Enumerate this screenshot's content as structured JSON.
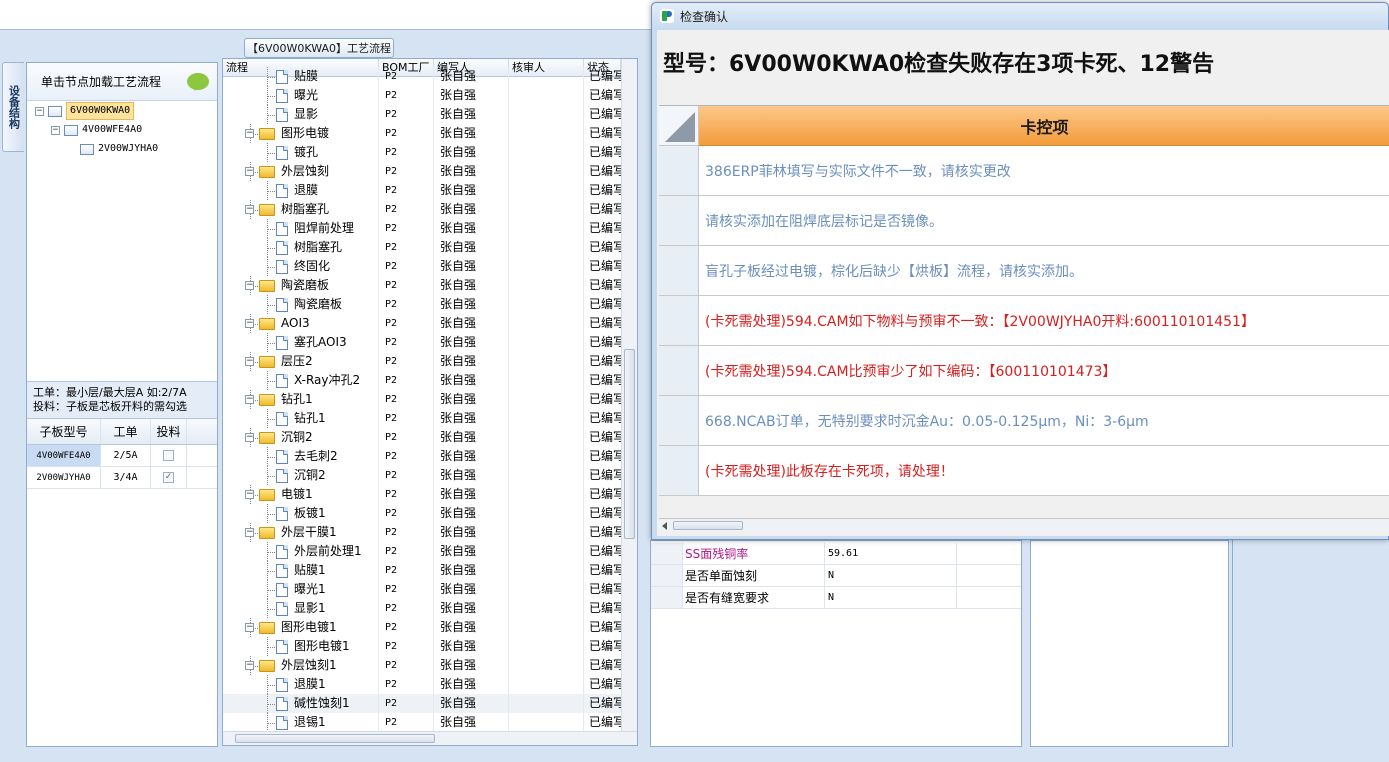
{
  "left": {
    "vtab": "设备结构",
    "header": "单击节点加载工艺流程",
    "tree": [
      {
        "label": "6V00W0KWA0",
        "level": 0,
        "selected": true
      },
      {
        "label": "4V00WFE4A0",
        "level": 1,
        "selected": false
      },
      {
        "label": "2V00WJYHA0",
        "level": 2,
        "selected": false
      }
    ],
    "info_line1": "工单：最小层/最大层A 如:2/7A",
    "info_line2": "投料：子板是芯板开料的需勾选",
    "subtable": {
      "headers": [
        "子板型号",
        "工单",
        "投料"
      ],
      "rows": [
        {
          "model": "4V00WFE4A0",
          "order": "2/5A",
          "feed": "",
          "highlight": true
        },
        {
          "model": "2V00WJYHA0",
          "order": "3/4A",
          "feed": "✓",
          "highlight": false
        }
      ]
    }
  },
  "flow": {
    "title": "【6V00W0KWA0】工艺流程",
    "headers": [
      "流程",
      "BOM工厂",
      "编写人",
      "核审人",
      "状态"
    ],
    "rows": [
      {
        "name": "贴膜",
        "type": "doc",
        "bom": "P2",
        "writer": "张自强",
        "status": "已编写"
      },
      {
        "name": "曝光",
        "type": "doc",
        "bom": "P2",
        "writer": "张自强",
        "status": "已编写"
      },
      {
        "name": "显影",
        "type": "doc",
        "bom": "P2",
        "writer": "张自强",
        "status": "已编写"
      },
      {
        "name": "图形电镀",
        "type": "folder",
        "bom": "P2",
        "writer": "张自强",
        "status": "已编写"
      },
      {
        "name": "镀孔",
        "type": "doc",
        "bom": "P2",
        "writer": "张自强",
        "status": "已编写"
      },
      {
        "name": "外层蚀刻",
        "type": "folder",
        "bom": "P2",
        "writer": "张自强",
        "status": "已编写"
      },
      {
        "name": "退膜",
        "type": "doc",
        "bom": "P2",
        "writer": "张自强",
        "status": "已编写"
      },
      {
        "name": "树脂塞孔",
        "type": "folder",
        "bom": "P2",
        "writer": "张自强",
        "status": "已编写"
      },
      {
        "name": "阻焊前处理",
        "type": "doc",
        "bom": "P2",
        "writer": "张自强",
        "status": "已编写"
      },
      {
        "name": "树脂塞孔",
        "type": "doc",
        "bom": "P2",
        "writer": "张自强",
        "status": "已编写"
      },
      {
        "name": "终固化",
        "type": "doc",
        "bom": "P2",
        "writer": "张自强",
        "status": "已编写"
      },
      {
        "name": "陶瓷磨板",
        "type": "folder",
        "bom": "P2",
        "writer": "张自强",
        "status": "已编写"
      },
      {
        "name": "陶瓷磨板",
        "type": "doc",
        "bom": "P2",
        "writer": "张自强",
        "status": "已编写"
      },
      {
        "name": "AOI3",
        "type": "folder",
        "bom": "P2",
        "writer": "张自强",
        "status": "已编写"
      },
      {
        "name": "塞孔AOI3",
        "type": "doc",
        "bom": "P2",
        "writer": "张自强",
        "status": "已编写"
      },
      {
        "name": "层压2",
        "type": "folder",
        "bom": "P2",
        "writer": "张自强",
        "status": "已编写"
      },
      {
        "name": "X-Ray冲孔2",
        "type": "doc",
        "bom": "P2",
        "writer": "张自强",
        "status": "已编写"
      },
      {
        "name": "钻孔1",
        "type": "folder",
        "bom": "P2",
        "writer": "张自强",
        "status": "已编写"
      },
      {
        "name": "钻孔1",
        "type": "doc",
        "bom": "P2",
        "writer": "张自强",
        "status": "已编写"
      },
      {
        "name": "沉铜2",
        "type": "folder",
        "bom": "P2",
        "writer": "张自强",
        "status": "已编写"
      },
      {
        "name": "去毛刺2",
        "type": "doc",
        "bom": "P2",
        "writer": "张自强",
        "status": "已编写"
      },
      {
        "name": "沉铜2",
        "type": "doc",
        "bom": "P2",
        "writer": "张自强",
        "status": "已编写"
      },
      {
        "name": "电镀1",
        "type": "folder",
        "bom": "P2",
        "writer": "张自强",
        "status": "已编写"
      },
      {
        "name": "板镀1",
        "type": "doc",
        "bom": "P2",
        "writer": "张自强",
        "status": "已编写"
      },
      {
        "name": "外层干膜1",
        "type": "folder",
        "bom": "P2",
        "writer": "张自强",
        "status": "已编写"
      },
      {
        "name": "外层前处理1",
        "type": "doc",
        "bom": "P2",
        "writer": "张自强",
        "status": "已编写"
      },
      {
        "name": "贴膜1",
        "type": "doc",
        "bom": "P2",
        "writer": "张自强",
        "status": "已编写"
      },
      {
        "name": "曝光1",
        "type": "doc",
        "bom": "P2",
        "writer": "张自强",
        "status": "已编写"
      },
      {
        "name": "显影1",
        "type": "doc",
        "bom": "P2",
        "writer": "张自强",
        "status": "已编写"
      },
      {
        "name": "图形电镀1",
        "type": "folder",
        "bom": "P2",
        "writer": "张自强",
        "status": "已编写"
      },
      {
        "name": "图形电镀1",
        "type": "doc",
        "bom": "P2",
        "writer": "张自强",
        "status": "已编写"
      },
      {
        "name": "外层蚀刻1",
        "type": "folder",
        "bom": "P2",
        "writer": "张自强",
        "status": "已编写"
      },
      {
        "name": "退膜1",
        "type": "doc",
        "bom": "P2",
        "writer": "张自强",
        "status": "已编写"
      },
      {
        "name": "碱性蚀刻1",
        "type": "doc",
        "bom": "P2",
        "writer": "张自强",
        "status": "已编写"
      },
      {
        "name": "退锡1",
        "type": "doc",
        "bom": "P2",
        "writer": "张自强",
        "status": "已编写"
      }
    ]
  },
  "props": [
    {
      "name": "SS面残铜率",
      "value": "59.61",
      "highlight": true
    },
    {
      "name": "是否单面蚀刻",
      "value": "N",
      "highlight": false
    },
    {
      "name": "是否有缝宽要求",
      "value": "N",
      "highlight": false
    }
  ],
  "dialog": {
    "title": "检查确认",
    "heading": "型号：6V00W0KWA0检查失败存在3项卡死、12警告",
    "table_title": "卡控项",
    "messages": [
      {
        "text": "386ERP菲林填写与实际文件不一致，请核实更改",
        "level": "warn"
      },
      {
        "text": "请核实添加在阻焊底层标记是否镜像。",
        "level": "warn"
      },
      {
        "text": "盲孔子板经过电镀，棕化后缺少【烘板】流程，请核实添加。",
        "level": "warn"
      },
      {
        "text": "(卡死需处理)594.CAM如下物料与预审不一致：【2V00WJYHA0开料:600110101451】",
        "level": "block"
      },
      {
        "text": "(卡死需处理)594.CAM比预审少了如下编码：【600110101473】",
        "level": "block"
      },
      {
        "text": "668.NCAB订单，无特别要求时沉金Au：0.05-0.125μm，Ni：3-6μm",
        "level": "warn"
      },
      {
        "text": "(卡死需处理)此板存在卡死项，请处理！",
        "level": "block"
      }
    ]
  },
  "colors": {
    "warn": "#6a8fbf",
    "block": "#d81e1e",
    "header_orange": "#f39c3a",
    "selected": "#fde39c"
  }
}
